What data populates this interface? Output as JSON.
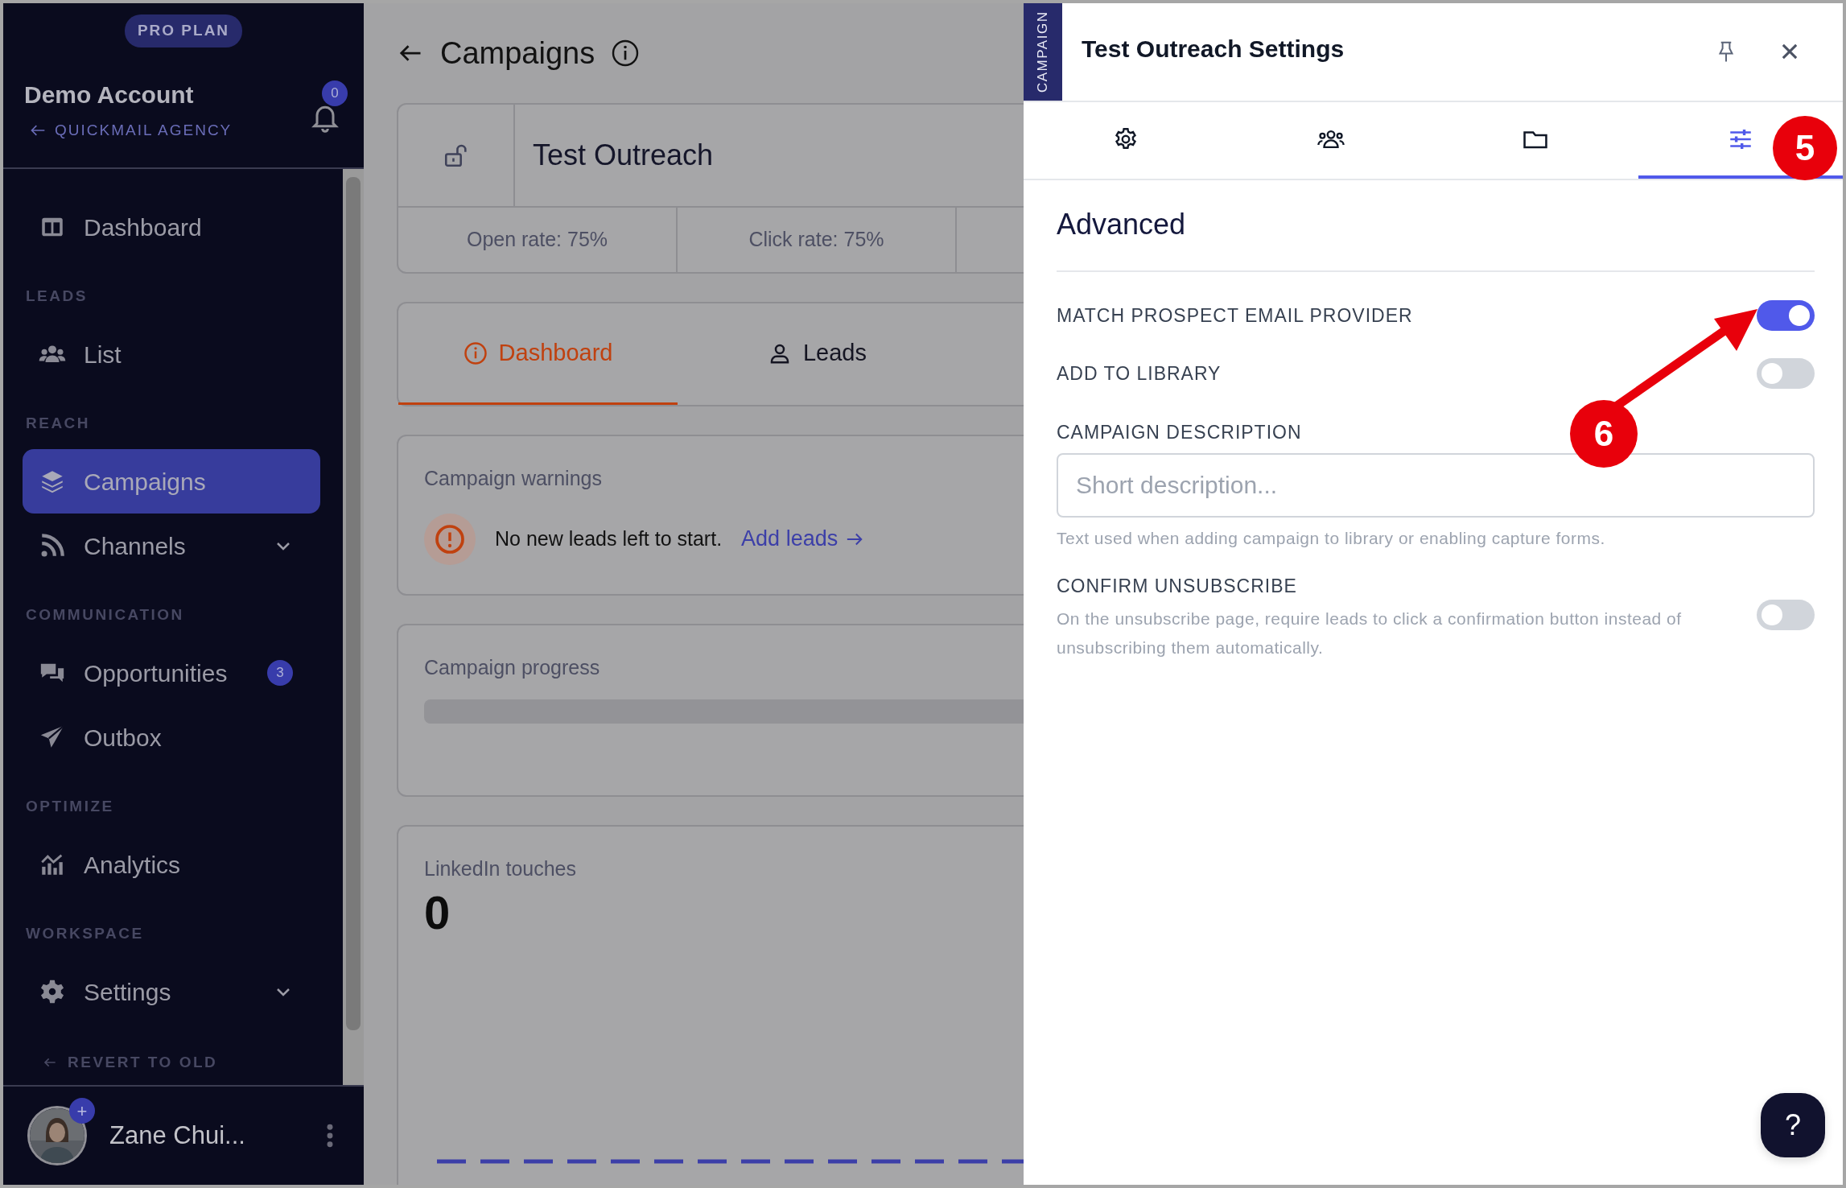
{
  "sidebar": {
    "plan_badge": "PRO PLAN",
    "account": "Demo Account",
    "agency": "QUICKMAIL AGENCY",
    "notifications": "0",
    "nav": [
      {
        "kind": "item",
        "label": "Dashboard",
        "selected": false
      },
      {
        "kind": "section",
        "label": "LEADS"
      },
      {
        "kind": "item",
        "label": "List",
        "selected": false
      },
      {
        "kind": "section",
        "label": "REACH"
      },
      {
        "kind": "item",
        "label": "Campaigns",
        "selected": true
      },
      {
        "kind": "group",
        "label": "Channels",
        "selected": false
      },
      {
        "kind": "section",
        "label": "COMMUNICATION"
      },
      {
        "kind": "item",
        "label": "Opportunities",
        "selected": false,
        "badge": "3"
      },
      {
        "kind": "item",
        "label": "Outbox",
        "selected": false
      },
      {
        "kind": "section",
        "label": "OPTIMIZE"
      },
      {
        "kind": "item",
        "label": "Analytics",
        "selected": false
      },
      {
        "kind": "section",
        "label": "WORKSPACE"
      },
      {
        "kind": "group",
        "label": "Settings",
        "selected": false
      }
    ],
    "revert": "REVERT TO OLD",
    "user": {
      "name": "Zane Chui...",
      "avatar_badge": "+"
    }
  },
  "main": {
    "title": "Campaigns",
    "campaign": {
      "name": "Test Outreach",
      "stats": [
        "Open rate: 75%",
        "Click rate: 75%"
      ]
    },
    "tabs": [
      {
        "label": "Dashboard",
        "selected": true
      },
      {
        "label": "Leads",
        "selected": false
      }
    ],
    "warnings": {
      "title": "Campaign warnings",
      "message": "No new leads left to start.",
      "link": "Add leads"
    },
    "progress": {
      "title": "Campaign progress"
    },
    "linkedin": {
      "title": "LinkedIn touches",
      "value": "0"
    }
  },
  "panel": {
    "side_tab": "CAMPAIGN",
    "title": "Test Outreach Settings",
    "tabs": [
      {
        "selected": false
      },
      {
        "selected": false
      },
      {
        "selected": false
      },
      {
        "selected": true
      }
    ],
    "section_title": "Advanced",
    "settings": [
      {
        "kind": "toggle",
        "label": "MATCH PROSPECT EMAIL PROVIDER",
        "on": true
      },
      {
        "kind": "toggle",
        "label": "ADD TO LIBRARY",
        "on": false
      },
      {
        "kind": "text",
        "label": "CAMPAIGN DESCRIPTION",
        "placeholder": "Short description...",
        "help": "Text used when adding campaign to library or enabling capture forms."
      },
      {
        "kind": "toggle",
        "label": "CONFIRM UNSUBSCRIBE",
        "description": "On the unsubscribe page, require leads to click a confirmation button instead of unsubscribing them automatically.",
        "on": false
      }
    ],
    "help_button": "?",
    "annotations": [
      "5",
      "6"
    ]
  }
}
